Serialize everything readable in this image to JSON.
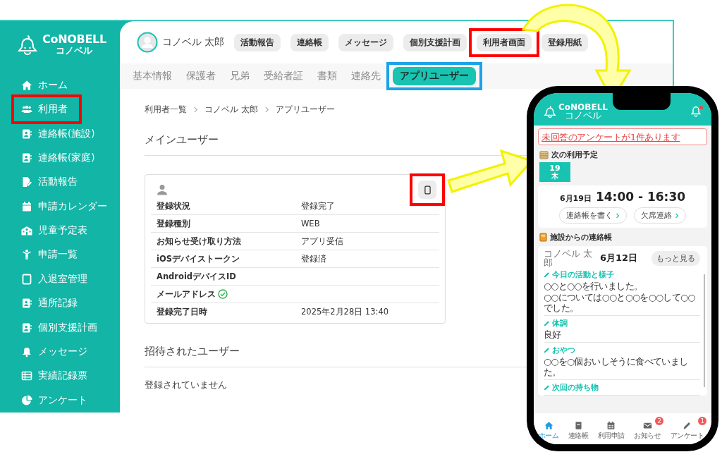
{
  "logo": {
    "name": "CoNOBELL",
    "subname": "コノベル"
  },
  "sidebar": {
    "items": [
      {
        "label": "ホーム",
        "highlighted": false
      },
      {
        "label": "利用者",
        "highlighted": true
      },
      {
        "label": "連絡帳(施設)",
        "highlighted": false
      },
      {
        "label": "連絡帳(家庭)",
        "highlighted": false
      },
      {
        "label": "活動報告",
        "highlighted": false
      },
      {
        "label": "申請カレンダー",
        "highlighted": false
      },
      {
        "label": "児童予定表",
        "highlighted": false
      },
      {
        "label": "申請一覧",
        "highlighted": false
      },
      {
        "label": "入退室管理",
        "highlighted": false
      },
      {
        "label": "通所記録",
        "highlighted": false
      },
      {
        "label": "個別支援計画",
        "highlighted": false
      },
      {
        "label": "メッセージ",
        "highlighted": false
      },
      {
        "label": "実績記録票",
        "highlighted": false
      },
      {
        "label": "アンケート",
        "highlighted": false
      }
    ]
  },
  "header": {
    "user_name": "コノベル 太郎",
    "buttons": [
      {
        "label": "活動報告",
        "highlighted": false
      },
      {
        "label": "連絡帳",
        "highlighted": false
      },
      {
        "label": "メッセージ",
        "highlighted": false
      },
      {
        "label": "個別支援計画",
        "highlighted": false
      },
      {
        "label": "利用者画面",
        "highlighted": true
      },
      {
        "label": "登録用紙",
        "highlighted": false
      }
    ]
  },
  "subtabs": [
    {
      "label": "基本情報",
      "selected": false,
      "highlighted": false
    },
    {
      "label": "保護者",
      "selected": false,
      "highlighted": false
    },
    {
      "label": "兄弟",
      "selected": false,
      "highlighted": false
    },
    {
      "label": "受給者証",
      "selected": false,
      "highlighted": false
    },
    {
      "label": "書類",
      "selected": false,
      "highlighted": false
    },
    {
      "label": "連絡先",
      "selected": false,
      "highlighted": false
    },
    {
      "label": "アプリユーザー",
      "selected": true,
      "highlighted": true
    }
  ],
  "breadcrumb": [
    "利用者一覧",
    "コノベル 太郎",
    "アプリユーザー"
  ],
  "main_user": {
    "title": "メインユーザー",
    "device_button": {
      "highlighted": true
    },
    "rows": [
      {
        "label": "登録状況",
        "value": "登録完了",
        "verified": false
      },
      {
        "label": "登録種別",
        "value": "WEB",
        "verified": false
      },
      {
        "label": "お知らせ受け取り方法",
        "value": "アプリ受信",
        "verified": false
      },
      {
        "label": "iOSデバイストークン",
        "value": "登録済",
        "verified": false
      },
      {
        "label": "AndroidデバイスID",
        "verified": false
      },
      {
        "label": "メールアドレス",
        "verified": true
      },
      {
        "label": "登録完了日時",
        "value": "2025年2月28日 13:40",
        "verified": false
      }
    ]
  },
  "invited_users": {
    "title": "招待されたユーザー",
    "empty_text": "登録されていません"
  },
  "phone": {
    "logo": {
      "name": "CoNOBELL",
      "subname": "コノベル"
    },
    "unread": true,
    "alert": "未回答のアンケートが1件あります",
    "schedule": {
      "title": "次の利用予定",
      "day": "19",
      "weekday": "木",
      "date": "6月19日",
      "time": "14:00 - 16:30",
      "buttons": [
        "連絡帳を書く",
        "欠席連絡"
      ]
    },
    "notebook": {
      "title": "施設からの連絡帳",
      "name": "コノベル 太郎",
      "date": "6月12日",
      "more": "もっと見る",
      "sections": [
        {
          "title": "今日の活動と様子",
          "lines": [
            "○○と○○を行いました。",
            "○○については○○と○○を○○して○○でした。"
          ]
        },
        {
          "title": "体調",
          "lines": [
            "良好"
          ]
        },
        {
          "title": "おやつ",
          "lines": [
            "○○を○個おいしそうに食べていました。"
          ]
        },
        {
          "title": "次回の持ち物"
        }
      ]
    },
    "nav": [
      {
        "label": "ホーム",
        "selected": true
      },
      {
        "label": "連絡帳",
        "selected": false
      },
      {
        "label": "利用申請",
        "selected": false
      },
      {
        "label": "お知らせ",
        "selected": false,
        "badge": "2"
      },
      {
        "label": "アンケート",
        "selected": false,
        "badge": "1"
      }
    ]
  }
}
